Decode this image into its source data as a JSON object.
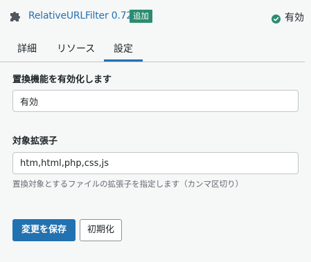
{
  "plugin": {
    "name": "RelativeURLFilter 0.72",
    "badge": "追加",
    "status": "有効"
  },
  "tabs": [
    {
      "label": "詳細",
      "active": false
    },
    {
      "label": "リソース",
      "active": false
    },
    {
      "label": "設定",
      "active": true
    }
  ],
  "settings": {
    "replace_label": "置換機能を有効化します",
    "replace_value": "有効",
    "ext_label": "対象拡張子",
    "ext_value": "htm,html,php,css,js",
    "ext_help": "置換対象とするファイルの拡張子を指定します（カンマ区切り）"
  },
  "buttons": {
    "save": "変更を保存",
    "reset": "初期化"
  },
  "colors": {
    "accent": "#2271b1",
    "badge": "#2b8c6f",
    "status_ok": "#2b8c6f"
  }
}
